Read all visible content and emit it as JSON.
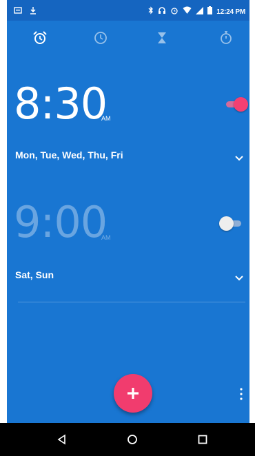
{
  "status_bar": {
    "time": "12:24 PM",
    "left_icons": [
      "cast-icon",
      "download-icon"
    ],
    "right_icons": [
      "bluetooth-icon",
      "headset-icon",
      "alarm-icon",
      "wifi-icon",
      "signal-icon",
      "battery-icon"
    ]
  },
  "tabs": [
    {
      "name": "alarm",
      "icon": "alarm-clock-icon",
      "active": true
    },
    {
      "name": "clock",
      "icon": "clock-icon",
      "active": false
    },
    {
      "name": "timer",
      "icon": "hourglass-icon",
      "active": false
    },
    {
      "name": "stopwatch",
      "icon": "stopwatch-icon",
      "active": false
    }
  ],
  "alarms": [
    {
      "time": "8:30",
      "ampm": "AM",
      "days": "Mon, Tue, Wed, Thu, Fri",
      "enabled": true
    },
    {
      "time": "9:00",
      "ampm": "AM",
      "days": "Sat, Sun",
      "enabled": false
    }
  ],
  "fab": {
    "icon": "plus-icon"
  },
  "overflow": {
    "icon": "more-vert-icon"
  },
  "nav": {
    "icons": [
      "back-icon",
      "home-icon",
      "recents-icon"
    ]
  },
  "colors": {
    "background": "#1976d2",
    "status_bar": "#1565c0",
    "accent": "#f13c6e",
    "nav_bar": "#000000"
  }
}
